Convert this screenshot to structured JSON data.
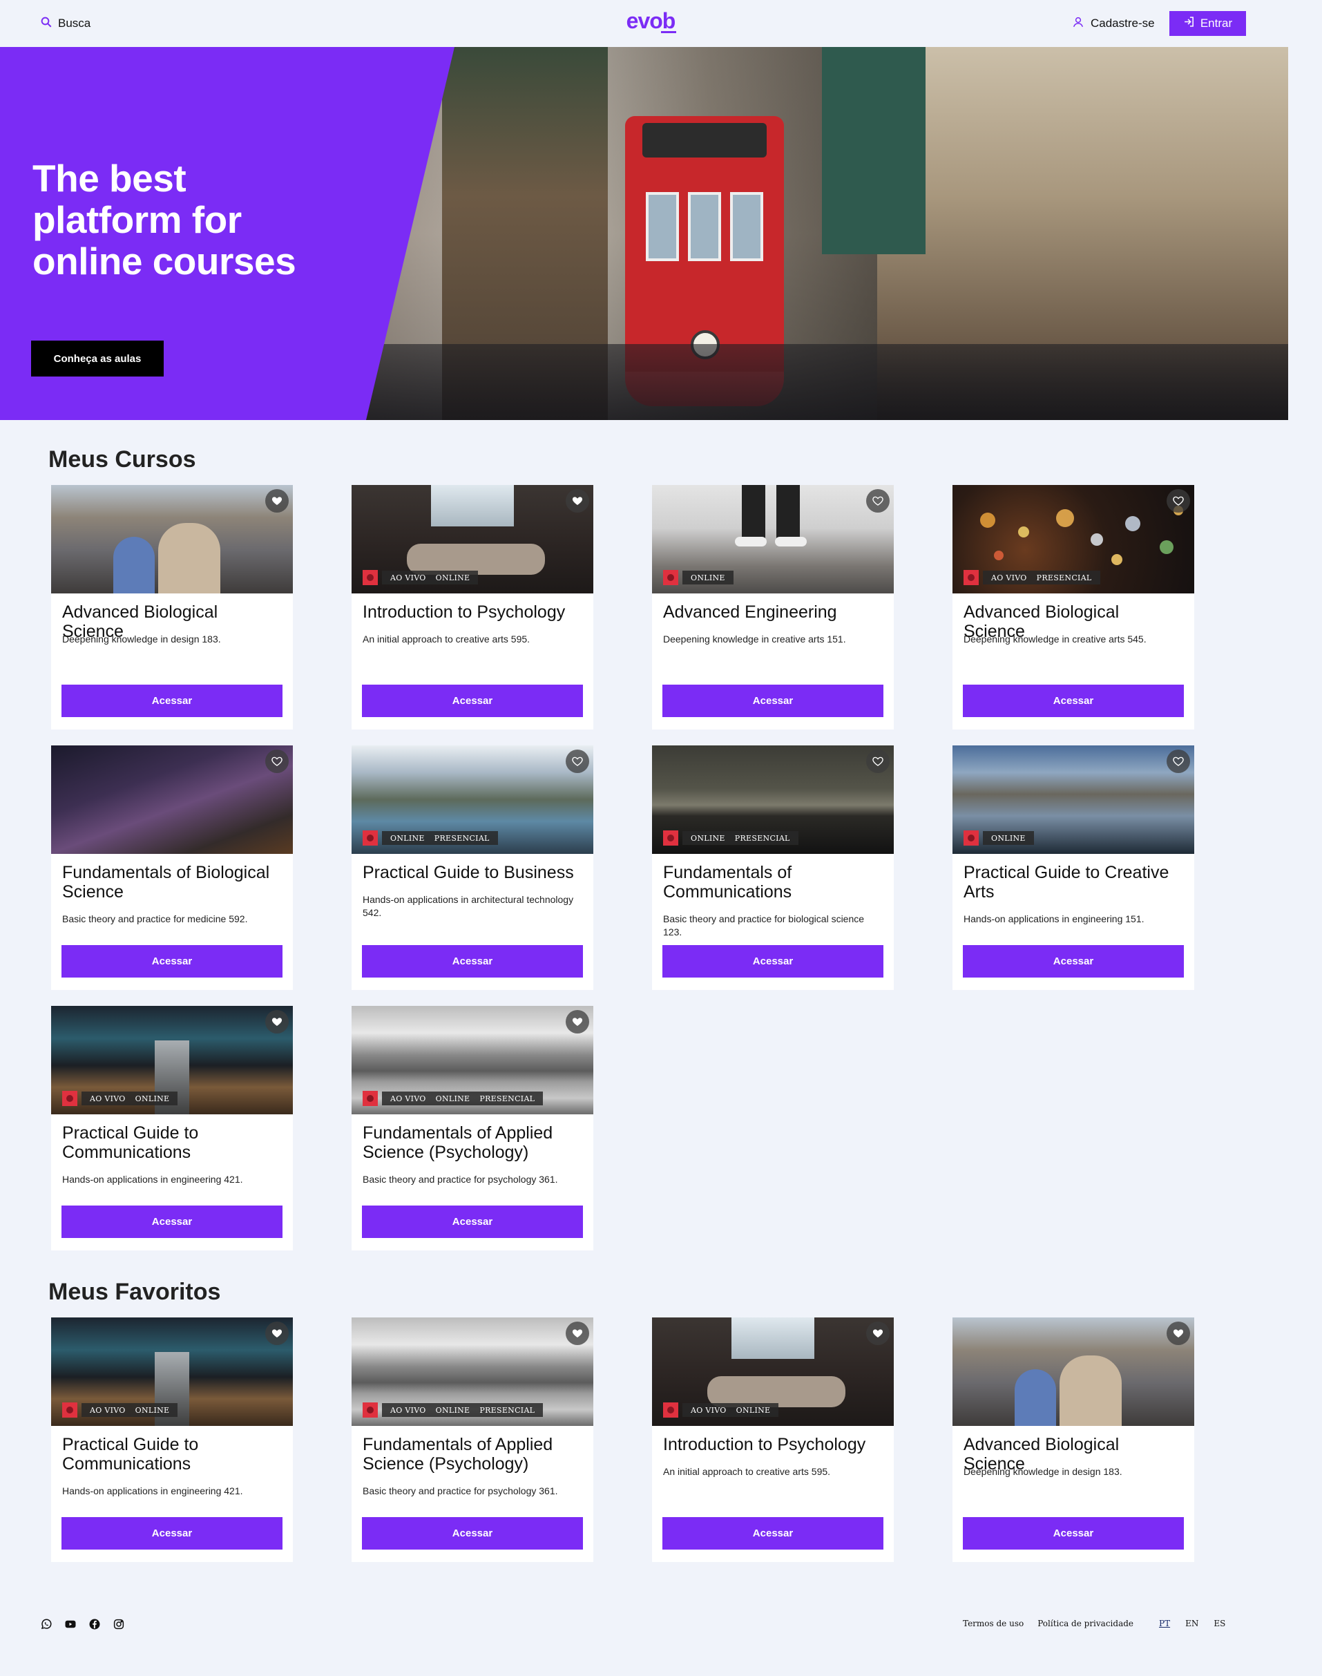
{
  "header": {
    "search_label": "Busca",
    "logo_text": "evob",
    "signup_label": "Cadastre-se",
    "login_label": "Entrar"
  },
  "hero": {
    "title": "The best platform for online courses",
    "cta_label": "Conheça as aulas"
  },
  "colors": {
    "accent": "#7b2cf5",
    "background": "#f0f3fa",
    "badge_red": "#e0313f"
  },
  "my_courses": {
    "title": "Meus Cursos",
    "cards": [
      {
        "title": "Advanced Biological Science",
        "description": "Deepening knowledge in design 183.",
        "tags": [],
        "button": "Acessar",
        "favorite": true,
        "image": "street-crowd"
      },
      {
        "title": "Introduction to Psychology",
        "description": "An initial approach to creative arts 595.",
        "tags": [
          "AO VIVO",
          "ONLINE"
        ],
        "button": "Acessar",
        "favorite": true,
        "image": "bedroom"
      },
      {
        "title": "Advanced Engineering",
        "description": "Deepening knowledge in creative arts 151.",
        "tags": [
          "ONLINE"
        ],
        "button": "Acessar",
        "favorite": false,
        "image": "feet-ground"
      },
      {
        "title": "Advanced Biological Science",
        "description": "Deepening knowledge in creative arts 545.",
        "tags": [
          "AO VIVO",
          "PRESENCIAL"
        ],
        "button": "Acessar",
        "favorite": false,
        "image": "bokeh-lights"
      },
      {
        "title": "Fundamentals of Biological Science",
        "description": "Basic theory and practice for medicine 592.",
        "tags": [],
        "button": "Acessar",
        "favorite": false,
        "image": "night-sky"
      },
      {
        "title": "Practical Guide to Business",
        "description": "Hands-on applications in architectural technology 542.",
        "tags": [
          "ONLINE",
          "PRESENCIAL"
        ],
        "button": "Acessar",
        "favorite": false,
        "image": "mountain-lake"
      },
      {
        "title": "Fundamentals of Communications",
        "description": "Basic theory and practice for biological science 123.",
        "tags": [
          "ONLINE",
          "PRESENCIAL"
        ],
        "button": "Acessar",
        "favorite": false,
        "image": "dark-sea"
      },
      {
        "title": "Practical Guide to Creative Arts",
        "description": "Hands-on applications in engineering 151.",
        "tags": [
          "ONLINE"
        ],
        "button": "Acessar",
        "favorite": false,
        "image": "mountain-reflection"
      },
      {
        "title": "Practical Guide to Communications",
        "description": "Hands-on applications in engineering 421.",
        "tags": [
          "AO VIVO",
          "ONLINE"
        ],
        "button": "Acessar",
        "favorite": true,
        "image": "station-escalator"
      },
      {
        "title": "Fundamentals of Applied Science (Psychology)",
        "description": "Basic theory and practice for psychology 361.",
        "tags": [
          "AO VIVO",
          "ONLINE",
          "PRESENCIAL"
        ],
        "button": "Acessar",
        "favorite": true,
        "image": "clouds-bw"
      }
    ]
  },
  "my_favorites": {
    "title": "Meus Favoritos",
    "cards": [
      {
        "title": "Practical Guide to Communications",
        "description": "Hands-on applications in engineering 421.",
        "tags": [
          "AO VIVO",
          "ONLINE"
        ],
        "button": "Acessar",
        "favorite": true,
        "image": "station-escalator"
      },
      {
        "title": "Fundamentals of Applied Science (Psychology)",
        "description": "Basic theory and practice for psychology 361.",
        "tags": [
          "AO VIVO",
          "ONLINE",
          "PRESENCIAL"
        ],
        "button": "Acessar",
        "favorite": true,
        "image": "clouds-bw"
      },
      {
        "title": "Introduction to Psychology",
        "description": "An initial approach to creative arts 595.",
        "tags": [
          "AO VIVO",
          "ONLINE"
        ],
        "button": "Acessar",
        "favorite": true,
        "image": "bedroom"
      },
      {
        "title": "Advanced Biological Science",
        "description": "Deepening knowledge in design 183.",
        "tags": [],
        "button": "Acessar",
        "favorite": true,
        "image": "street-crowd"
      }
    ]
  },
  "footer": {
    "social_icons": [
      "whatsapp-icon",
      "youtube-icon",
      "facebook-icon",
      "instagram-icon"
    ],
    "terms_label": "Termos de uso",
    "privacy_label": "Política de privacidade",
    "languages": [
      "PT",
      "EN",
      "ES"
    ],
    "active_language": "PT"
  }
}
